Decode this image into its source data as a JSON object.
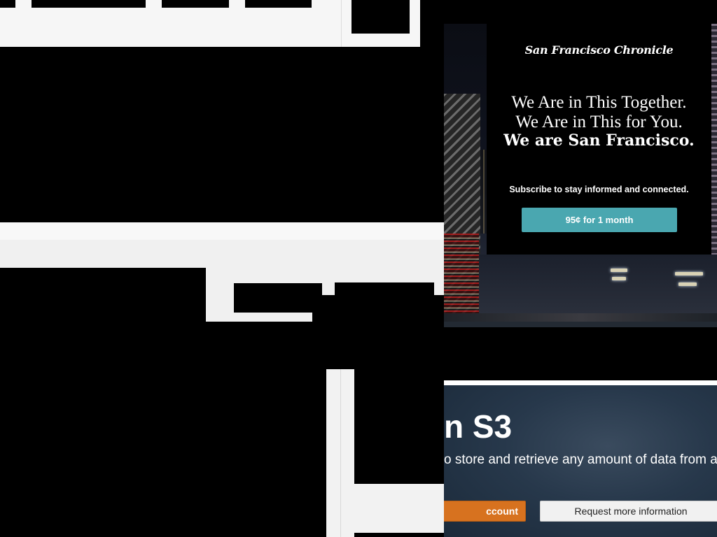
{
  "chronicle": {
    "logo": "San Francisco Chronicle",
    "headline_1": "We Are in This Together.",
    "headline_2": "We Are in This for You.",
    "headline_3": "We are San Francisco.",
    "subtext": "Subscribe to stay informed and connected.",
    "cta": "95¢ for 1 month",
    "cta_color": "#4aa7b0"
  },
  "aws": {
    "title": "n S3",
    "description": "o store and retrieve any amount of data from a",
    "primary_button": "ccount",
    "secondary_button": "Request more information",
    "primary_color": "#d7721f"
  }
}
